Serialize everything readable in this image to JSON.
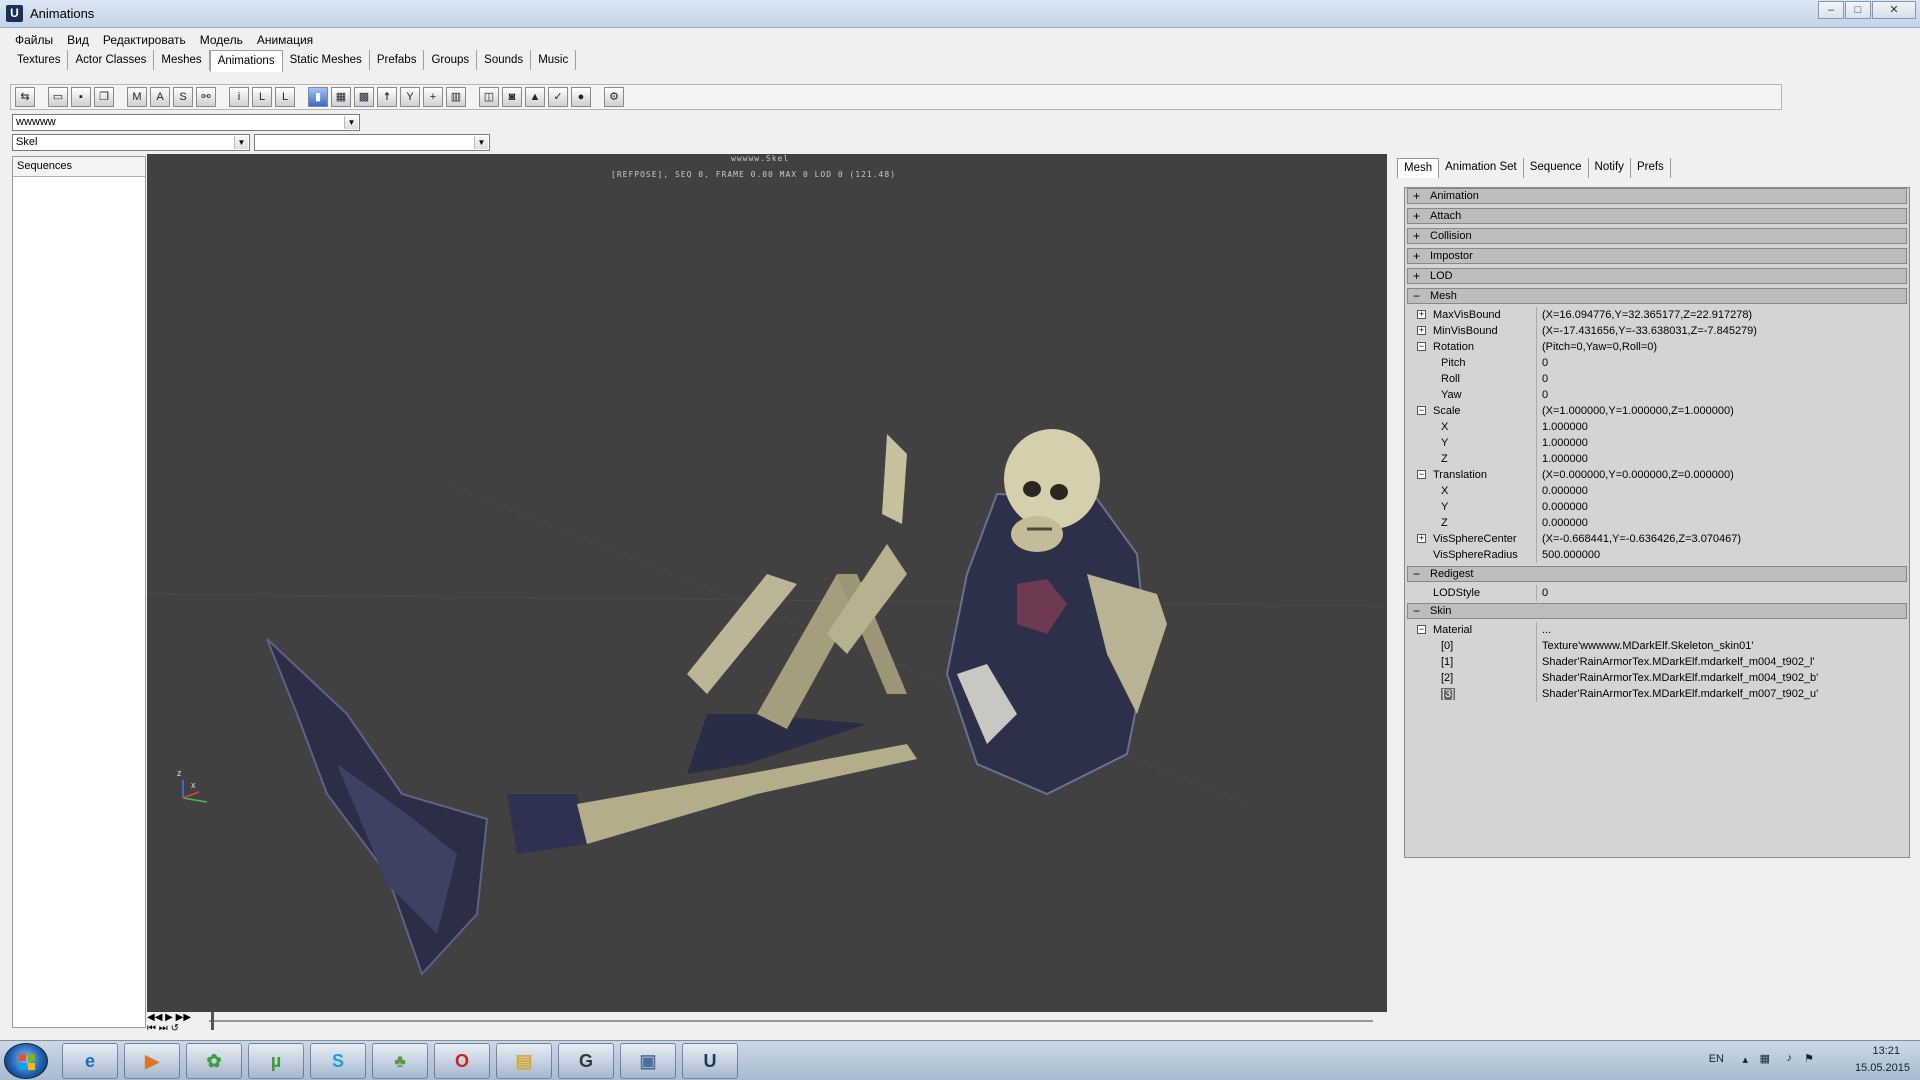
{
  "window": {
    "title": "Animations",
    "minimize": "–",
    "maximize": "□",
    "close": "✕"
  },
  "menu": [
    "Файлы",
    "Вид",
    "Редактировать",
    "Модель",
    "Анимация"
  ],
  "tabs": [
    "Textures",
    "Actor Classes",
    "Meshes",
    "Animations",
    "Static Meshes",
    "Prefabs",
    "Groups",
    "Sounds",
    "Music"
  ],
  "active_tab": "Animations",
  "toolbar_icons": [
    "import-icon",
    "open-icon",
    "save-icon",
    "copy-icon",
    "mesh-props-icon",
    "anim-props-icon",
    "seq-props-icon",
    "link-icon",
    "bone-icon",
    "lod-icon",
    "lod2-icon",
    "lod3-icon",
    "book-icon",
    "wire-icon",
    "grid-icon",
    "skeleton-icon",
    "bones-icon",
    "axis-icon",
    "highlight-icon",
    "export-icon",
    "camera-icon",
    "graph-icon",
    "apply-icon",
    "reset-icon",
    "prefs-icon"
  ],
  "combos": {
    "mesh_value": "wwwww",
    "anim_value": "Skel",
    "seq_value": ""
  },
  "sequences": {
    "header": "Sequences"
  },
  "viewport": {
    "line1": "wwwww.Skel",
    "line2": "[REFPOSE],  SEQ 0,  FRAME  0.00 MAX 0  LOD 0  (121.48)",
    "axis_z": "z",
    "axis_x": "x"
  },
  "timeline": {
    "buttons": [
      "◀◀",
      "▶",
      "▶▶",
      "⏮",
      "⏭",
      "↺"
    ]
  },
  "right_tabs": [
    "Mesh",
    "Animation Set",
    "Sequence",
    "Notify",
    "Prefs"
  ],
  "active_right_tab": "Mesh",
  "properties": {
    "categories": {
      "animation": "Animation",
      "attach": "Attach",
      "collision": "Collision",
      "impostor": "Impostor",
      "lod": "LOD",
      "mesh": "Mesh",
      "redigest": "Redigest",
      "skin": "Skin"
    },
    "expand_collapsed": "+",
    "expand_open": "−",
    "rows": {
      "maxvisbound": {
        "key": "MaxVisBound",
        "value": "(X=16.094776,Y=32.365177,Z=22.917278)"
      },
      "minvisbound": {
        "key": "MinVisBound",
        "value": "(X=-17.431656,Y=-33.638031,Z=-7.845279)"
      },
      "rotation": {
        "key": "Rotation",
        "value": "(Pitch=0,Yaw=0,Roll=0)"
      },
      "pitch": {
        "key": "Pitch",
        "value": "0"
      },
      "roll": {
        "key": "Roll",
        "value": "0"
      },
      "yaw": {
        "key": "Yaw",
        "value": "0"
      },
      "scale": {
        "key": "Scale",
        "value": "(X=1.000000,Y=1.000000,Z=1.000000)"
      },
      "scale_x": {
        "key": "X",
        "value": "1.000000"
      },
      "scale_y": {
        "key": "Y",
        "value": "1.000000"
      },
      "scale_z": {
        "key": "Z",
        "value": "1.000000"
      },
      "translation": {
        "key": "Translation",
        "value": "(X=0.000000,Y=0.000000,Z=0.000000)"
      },
      "trans_x": {
        "key": "X",
        "value": "0.000000"
      },
      "trans_y": {
        "key": "Y",
        "value": "0.000000"
      },
      "trans_z": {
        "key": "Z",
        "value": "0.000000"
      },
      "vissphere_center": {
        "key": "VisSphereCenter",
        "value": "(X=-0.668441,Y=-0.636426,Z=3.070467)"
      },
      "vissphere_radius": {
        "key": "VisSphereRadius",
        "value": "500.000000"
      },
      "lodstyle": {
        "key": "LODStyle",
        "value": "0"
      },
      "material": {
        "key": "Material",
        "value": "..."
      },
      "mat0": {
        "key": "[0]",
        "value": "Texture'wwwww.MDarkElf.Skeleton_skin01'"
      },
      "mat1": {
        "key": "[1]",
        "value": "Shader'RainArmorTex.MDarkElf.mdarkelf_m004_t902_l'"
      },
      "mat2": {
        "key": "[2]",
        "value": "Shader'RainArmorTex.MDarkElf.mdarkelf_m004_t902_b'"
      },
      "mat3": {
        "key": "[3]",
        "value": "Shader'RainArmorTex.MDarkElf.mdarkelf_m007_t902_u'"
      }
    }
  },
  "taskbar": {
    "apps": [
      {
        "name": "media-player-taskbar-icon",
        "glyph": "▶",
        "color": "#e0742a"
      },
      {
        "name": "icq-taskbar-icon",
        "glyph": "✿",
        "color": "#3aa13a"
      },
      {
        "name": "utorrent-taskbar-icon",
        "glyph": "µ",
        "color": "#3c9c2f"
      },
      {
        "name": "skype-taskbar-icon",
        "glyph": "S",
        "color": "#1aa0e0"
      },
      {
        "name": "tool-taskbar-icon",
        "glyph": "♣",
        "color": "#5a9a4a"
      },
      {
        "name": "opera-taskbar-icon",
        "glyph": "O",
        "color": "#d0201c"
      },
      {
        "name": "explorer-taskbar-icon",
        "glyph": "▤",
        "color": "#d9a630"
      },
      {
        "name": "app-taskbar-icon",
        "glyph": "G",
        "color": "#2a3a3a"
      },
      {
        "name": "window-taskbar-icon",
        "glyph": "▣",
        "color": "#4d6f9c"
      },
      {
        "name": "unreal-taskbar-icon",
        "glyph": "U",
        "color": "#1d3c4a"
      }
    ],
    "lang": "EN",
    "time": "13:21",
    "date": "15.05.2015"
  }
}
